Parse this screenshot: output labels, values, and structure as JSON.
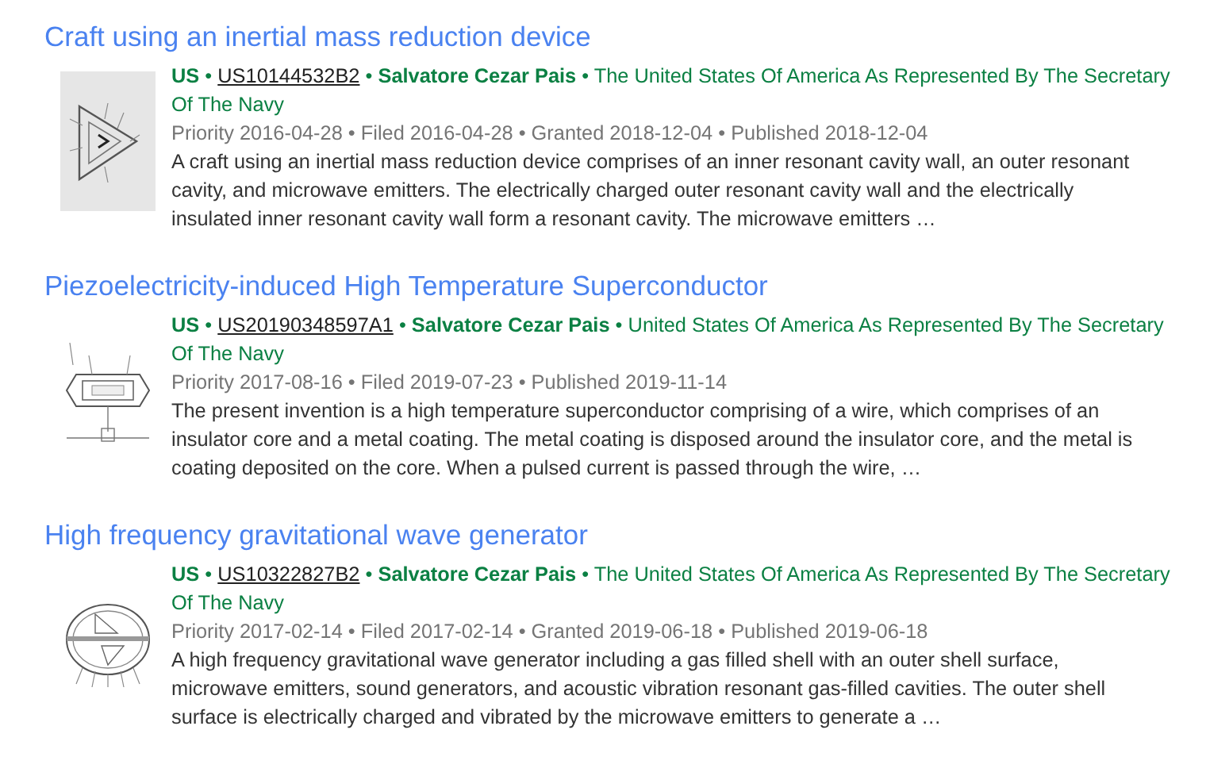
{
  "results": [
    {
      "title": "Craft using an inertial mass reduction device",
      "thumbnail": {
        "kind": "picture",
        "shaded": true
      },
      "meta": [
        {
          "kind": "country",
          "text": "US"
        },
        {
          "kind": "separator",
          "text": "•"
        },
        {
          "kind": "number",
          "text": "US10144532B2"
        },
        {
          "kind": "separator",
          "text": "•"
        },
        {
          "kind": "inventor",
          "text": "Salvatore Cezar Pais"
        },
        {
          "kind": "separator",
          "text": "•"
        },
        {
          "kind": "assignee",
          "text": "The United States Of America As Represented By The Secretary Of The Navy"
        }
      ],
      "dates": "Priority 2016-04-28 • Filed 2016-04-28 • Granted 2018-12-04 • Published 2018-12-04",
      "snippet": "A craft using an inertial mass reduction device comprises of an inner resonant cavity wall, an outer resonant cavity, and microwave emitters. The electrically charged outer resonant cavity wall and the electrically insulated inner resonant cavity wall form a resonant cavity. The microwave emitters …"
    },
    {
      "title": "Piezoelectricity-induced High Temperature Superconductor",
      "thumbnail": {
        "kind": "picture",
        "shaded": false
      },
      "meta": [
        {
          "kind": "country",
          "text": "US"
        },
        {
          "kind": "separator",
          "text": "•"
        },
        {
          "kind": "number",
          "text": "US20190348597A1"
        },
        {
          "kind": "separator",
          "text": "•"
        },
        {
          "kind": "inventor",
          "text": "Salvatore Cezar Pais"
        },
        {
          "kind": "separator",
          "text": "•"
        },
        {
          "kind": "assignee",
          "text": "United States Of America As Represented By The Secretary Of The Navy"
        }
      ],
      "dates": "Priority 2017-08-16 • Filed 2019-07-23 • Published 2019-11-14",
      "snippet": "The present invention is a high temperature superconductor comprising of a wire, which comprises of an insulator core and a metal coating. The metal coating is disposed around the insulator core, and the metal is coating deposited on the core. When a pulsed current is passed through the wire, …"
    },
    {
      "title": "High frequency gravitational wave generator",
      "thumbnail": {
        "kind": "picture",
        "shaded": false
      },
      "meta": [
        {
          "kind": "country",
          "text": "US"
        },
        {
          "kind": "separator",
          "text": "•"
        },
        {
          "kind": "number",
          "text": "US10322827B2"
        },
        {
          "kind": "separator",
          "text": "•"
        },
        {
          "kind": "inventor",
          "text": "Salvatore Cezar Pais"
        },
        {
          "kind": "separator",
          "text": "•"
        },
        {
          "kind": "assignee",
          "text": "The United States Of America As Represented By The Secretary Of The Navy"
        }
      ],
      "dates": "Priority 2017-02-14 • Filed 2017-02-14 • Granted 2019-06-18 • Published 2019-06-18",
      "snippet": "A high frequency gravitational wave generator including a gas filled shell with an outer shell surface, microwave emitters, sound generators, and acoustic vibration resonant gas-filled cavities. The outer shell surface is electrically charged and vibrated by the microwave emitters to generate a …"
    }
  ]
}
